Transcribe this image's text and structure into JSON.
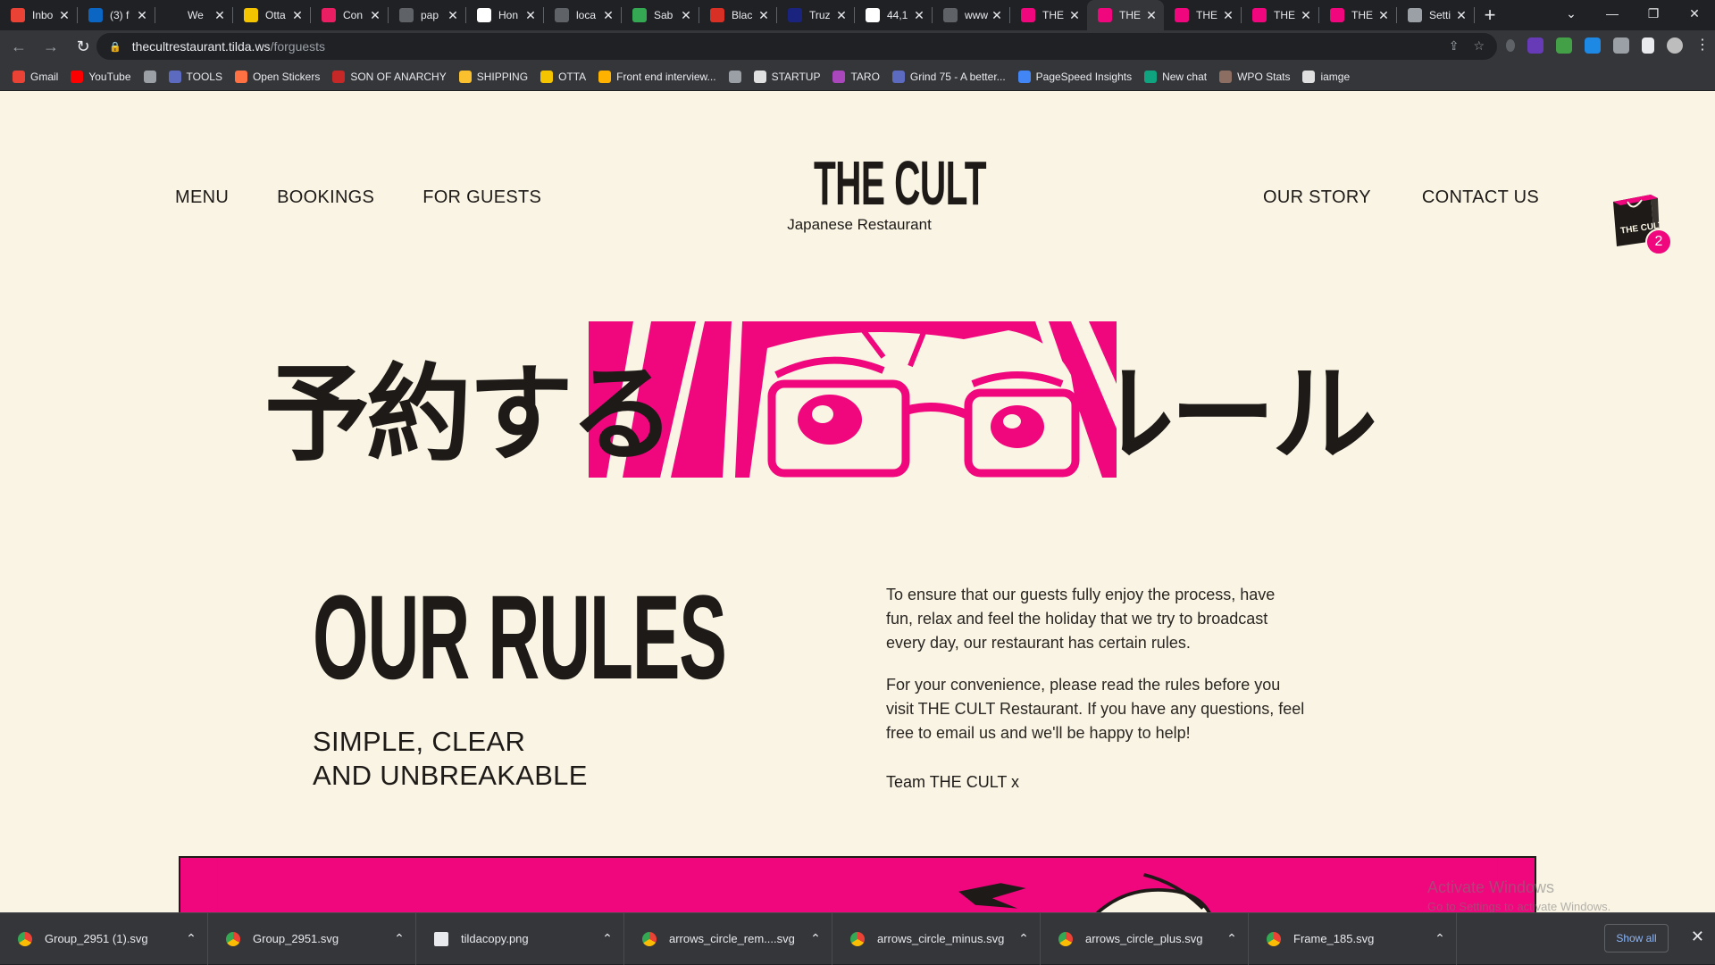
{
  "browser": {
    "tabs": [
      {
        "label": "Inbo",
        "color": "#ea4335"
      },
      {
        "label": "(3) f",
        "color": "#0a66c2"
      },
      {
        "label": "We",
        "color": "#202124"
      },
      {
        "label": "Otta",
        "color": "#f5c400"
      },
      {
        "label": "Con",
        "color": "#e91e63"
      },
      {
        "label": "pap",
        "color": "#5f6368"
      },
      {
        "label": "Hon",
        "color": "#ffffff"
      },
      {
        "label": "loca",
        "color": "#5f6368"
      },
      {
        "label": "Sab",
        "color": "#34a853"
      },
      {
        "label": "Blac",
        "color": "#d93025"
      },
      {
        "label": "Truz",
        "color": "#1a237e"
      },
      {
        "label": "44,1",
        "color": "#ffffff"
      },
      {
        "label": "www",
        "color": "#5f6368"
      },
      {
        "label": "THE",
        "color": "#f0067d"
      },
      {
        "label": "THE",
        "color": "#f0067d",
        "active": true
      },
      {
        "label": "THE",
        "color": "#f0067d"
      },
      {
        "label": "THE",
        "color": "#f0067d"
      },
      {
        "label": "THE",
        "color": "#f0067d"
      },
      {
        "label": "Setti",
        "color": "#9aa0a6"
      }
    ],
    "address_host": "thecultrestaurant.tilda.ws",
    "address_path": "/forguests",
    "bookmarks": [
      {
        "label": "Gmail",
        "color": "#ea4335"
      },
      {
        "label": "YouTube",
        "color": "#ff0000"
      },
      {
        "label": "",
        "color": "#9aa0a6"
      },
      {
        "label": "TOOLS",
        "color": "#5c6bc0"
      },
      {
        "label": "Open Stickers",
        "color": "#ff7043"
      },
      {
        "label": "SON OF ANARCHY",
        "color": "#c62828"
      },
      {
        "label": "SHIPPING",
        "color": "#fbc02d"
      },
      {
        "label": "OTTA",
        "color": "#f5c400"
      },
      {
        "label": "Front end interview...",
        "color": "#ffb300"
      },
      {
        "label": "",
        "color": "#9aa0a6"
      },
      {
        "label": "STARTUP",
        "color": "#e0e0e0"
      },
      {
        "label": "TARO",
        "color": "#ab47bc"
      },
      {
        "label": "Grind 75 - A better...",
        "color": "#5c6bc0"
      },
      {
        "label": "PageSpeed Insights",
        "color": "#4285f4"
      },
      {
        "label": "New chat",
        "color": "#10a37f"
      },
      {
        "label": "WPO Stats",
        "color": "#8d6e63"
      },
      {
        "label": "iamge",
        "color": "#e0e0e0"
      }
    ]
  },
  "site": {
    "nav_left": [
      "MENU",
      "BOOKINGS",
      "FOR GUESTS"
    ],
    "nav_right": [
      "OUR STORY",
      "CONTACT US"
    ],
    "logo_title": "THE CULT",
    "logo_subtitle": "Japanese Restaurant",
    "cart_count": "2",
    "hero_jp_left": "予約する",
    "hero_jp_right": "ルール",
    "rules_title": "OUR RULES",
    "rules_sub_line1": "SIMPLE, CLEAR",
    "rules_sub_line2": "AND UNBREAKABLE",
    "rules_paragraph1": "To ensure that our guests fully enjoy the process, have fun, relax and feel the holiday that we try to broadcast every day, our restaurant has certain rules.",
    "rules_paragraph2": "For your convenience, please read the rules before you visit THE CULT Restaurant. If you have any questions, feel free to email us and we'll be happy to help!",
    "rules_sign": "Team THE CULT x",
    "accent_color": "#f0067d"
  },
  "watermark": {
    "line1": "Activate Windows",
    "line2": "Go to Settings to activate Windows."
  },
  "downloads": {
    "items": [
      "Group_2951 (1).svg",
      "Group_2951.svg",
      "tildacopy.png",
      "arrows_circle_rem....svg",
      "arrows_circle_minus.svg",
      "arrows_circle_plus.svg",
      "Frame_185.svg"
    ],
    "show_all": "Show all"
  }
}
